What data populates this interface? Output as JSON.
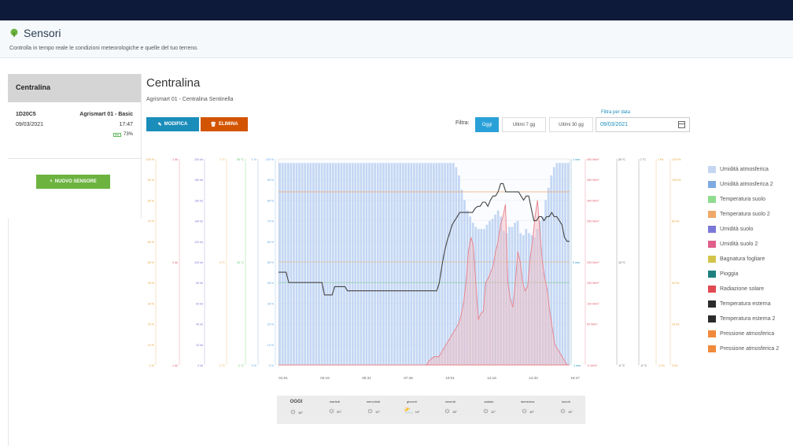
{
  "header": {
    "title": "Sensori",
    "subtitle": "Controlla in tempo reale le condizioni meteorologiche e quelle del tuo terreno."
  },
  "sidebar": {
    "heading": "Centralina",
    "sensor": {
      "id": "1D20C5",
      "model": "Agrismart 01 - Basic",
      "date": "09/03/2021",
      "time": "17:47",
      "battery": "73%"
    },
    "new_button": "NUOVO SENSORE"
  },
  "main": {
    "title": "Centralina",
    "subtitle": "Agrismart 01 - Centralina Sentinella",
    "edit_button": "MODIFICA",
    "delete_button": "ELIMINA",
    "filter_label": "Filtra:",
    "filters": [
      "Oggi",
      "Ultimi 7 gg",
      "Ultimi 30 gg"
    ],
    "active_filter": "Oggi",
    "date_filter_label": "Filtra per data",
    "date_value": "09/03/2021"
  },
  "colors": {
    "accent": "#1b8dbb",
    "danger": "#d35400",
    "success": "#6cb33f"
  },
  "chart_data": {
    "type": "line",
    "x_ticks": [
      "01:01",
      "03:16",
      "05:31",
      "07:46",
      "10:01",
      "12:16",
      "14:32",
      "16:47"
    ],
    "x_start": 0,
    "x_end": 1060,
    "axes_left": [
      {
        "color": "#e8a33a",
        "ticks": [
          "100 %",
          "90 %",
          "80 %",
          "70 %",
          "60 %",
          "50 %",
          "40 %",
          "30 %",
          "20 %",
          "10 %",
          "0 %"
        ]
      },
      {
        "color": "#e05a6a",
        "ticks": [
          "1 dk",
          "",
          "",
          "",
          "",
          "0 dk",
          "",
          "",
          "",
          "",
          "-1 dk"
        ]
      },
      {
        "color": "#7a7ad8",
        "ticks": [
          "200 kb",
          "180 kb",
          "160 kb",
          "140 kb",
          "120 kb",
          "100 kb",
          "80 kb",
          "60 kb",
          "40 kb",
          "20 kb",
          "0 kb"
        ]
      },
      {
        "color": "#e8a33a",
        "ticks": [
          "1 °C",
          "",
          "",
          "",
          "",
          "0 °C",
          "",
          "",
          "",
          "",
          "-1 °C"
        ]
      },
      {
        "color": "#5cc35c",
        "ticks": [
          "35 °C",
          "",
          "",
          "",
          "",
          "10 °C",
          "",
          "",
          "",
          "",
          "-1 °C"
        ]
      },
      {
        "color": "#5aa0e0",
        "ticks": [
          "1 %",
          "",
          "",
          "",
          "",
          "",
          "",
          "",
          "",
          "",
          "0 %"
        ]
      },
      {
        "color": "#5aa0e0",
        "ticks": [
          "100 %",
          "90 %",
          "80 %",
          "70 %",
          "60 %",
          "50 %",
          "40 %",
          "30 %",
          "20 %",
          "10 %",
          "0 %"
        ]
      }
    ],
    "axes_right": [
      {
        "color": "#1b8dbb",
        "ticks": [
          "1 mm",
          "",
          "",
          "",
          "",
          "0 mm",
          "",
          "",
          "",
          "",
          "-1 mm"
        ]
      },
      {
        "color": "#e05a6a",
        "ticks": [
          "400 W/m²",
          "350 W/m²",
          "300 W/m²",
          "250 W/m²",
          "",
          "200 W/m²",
          "150 W/m²",
          "100 W/m²",
          "50 W/m²",
          "",
          "-0 W/m²"
        ]
      },
      {
        "color": "#555555",
        "ticks": [
          "20 °C",
          "",
          "",
          "",
          "",
          "10 °C",
          "",
          "",
          "",
          "",
          "-0 °C"
        ]
      },
      {
        "color": "#555555",
        "ticks": [
          "1 °C",
          "",
          "",
          "",
          "",
          "",
          "",
          "",
          "",
          "",
          "-0 °C"
        ]
      },
      {
        "color": "#e8a33a",
        "ticks": [
          "1 Pa",
          "",
          "",
          "",
          "",
          "",
          "",
          "",
          "",
          "",
          "-1 Pa"
        ]
      },
      {
        "color": "#e8a33a",
        "ticks": [
          "120 Pa",
          "100 Pa",
          "",
          "80 Pa",
          "",
          "",
          "40 Pa",
          "",
          "20 Pa",
          "",
          "0 Pa"
        ]
      }
    ],
    "series": [
      {
        "name": "Umidità atmosferica",
        "color": "#b7cdf0",
        "kind": "bars",
        "values": [
          98,
          98,
          98,
          98,
          98,
          98,
          98,
          98,
          98,
          98,
          98,
          98,
          98,
          98,
          98,
          98,
          98,
          98,
          98,
          98,
          98,
          98,
          98,
          98,
          98,
          98,
          98,
          98,
          98,
          98,
          98,
          98,
          98,
          98,
          98,
          98,
          98,
          98,
          98,
          98,
          98,
          98,
          98,
          98,
          98,
          98,
          98,
          98,
          98,
          98,
          98,
          98,
          98,
          98,
          98,
          98,
          98,
          98,
          98,
          98,
          98,
          98,
          98,
          96,
          92,
          85,
          80,
          75,
          72,
          69,
          67,
          66,
          66,
          66,
          68,
          70,
          71,
          73,
          75,
          72,
          65,
          64,
          67,
          67,
          69,
          70,
          64,
          63,
          66,
          64,
          63,
          62,
          66,
          70,
          72,
          80,
          86,
          92,
          96,
          98,
          98,
          98,
          98,
          98
        ]
      },
      {
        "name": "Temperatura esterna",
        "color": "#444444",
        "kind": "line",
        "values": [
          45,
          45,
          45,
          45,
          40,
          40,
          40,
          40,
          40,
          40,
          40,
          40,
          40,
          40,
          40,
          40,
          40,
          40,
          34,
          34,
          34,
          34,
          38,
          38,
          38,
          38,
          38,
          36,
          36,
          36,
          36,
          36,
          36,
          36,
          36,
          36,
          36,
          36,
          36,
          36,
          36,
          36,
          36,
          36,
          36,
          36,
          36,
          36,
          36,
          36,
          36,
          36,
          36,
          36,
          36,
          36,
          36,
          36,
          36,
          36,
          36,
          36,
          36,
          40,
          48,
          55,
          60,
          64,
          68,
          70,
          72,
          74,
          74,
          74,
          74,
          74,
          74,
          76,
          77,
          77,
          79,
          79,
          77,
          80,
          82,
          82,
          84,
          88,
          88,
          84,
          84,
          84,
          84,
          84,
          84,
          82,
          80,
          82,
          82,
          76,
          70,
          70,
          72,
          72,
          70,
          72,
          72,
          74,
          72,
          72,
          70,
          68,
          62,
          60,
          60
        ]
      },
      {
        "name": "Radiazione solare",
        "color": "#e8808a",
        "kind": "area",
        "values": [
          0,
          0,
          0,
          0,
          0,
          0,
          0,
          0,
          0,
          0,
          0,
          0,
          0,
          0,
          0,
          0,
          0,
          0,
          0,
          0,
          0,
          0,
          0,
          0,
          0,
          0,
          0,
          0,
          0,
          0,
          0,
          0,
          0,
          0,
          0,
          0,
          0,
          0,
          0,
          0,
          0,
          0,
          0,
          0,
          0,
          0,
          0,
          0,
          0,
          0,
          0,
          0,
          0,
          0,
          0,
          0,
          0,
          0,
          0,
          0,
          0,
          2,
          3,
          4,
          4,
          4,
          6,
          8,
          10,
          12,
          14,
          16,
          18,
          20,
          24,
          30,
          40,
          55,
          62,
          58,
          40,
          22,
          25,
          26,
          40,
          42,
          45,
          48,
          55,
          60,
          68,
          72,
          78,
          40,
          32,
          28,
          40,
          55,
          50,
          40,
          36,
          38,
          52,
          60,
          72,
          80,
          64,
          50,
          42,
          36,
          26,
          18,
          10,
          8,
          6,
          4,
          2,
          0,
          0
        ]
      },
      {
        "name": "Pressione atmosferica",
        "color": "#f0a068",
        "kind": "step",
        "values": [
          84,
          84,
          84,
          84,
          84,
          84,
          84,
          84,
          84,
          84,
          84,
          84,
          84,
          84,
          84,
          84,
          84,
          84,
          84,
          84,
          84,
          84,
          84,
          84,
          84,
          84,
          84,
          84,
          84,
          84,
          84,
          84,
          84,
          84,
          84,
          84,
          84,
          84,
          84,
          84,
          84,
          84,
          84,
          84,
          84,
          84,
          84,
          84,
          84,
          84,
          84,
          84,
          84,
          84,
          84,
          84,
          84,
          84,
          84,
          84,
          84,
          84,
          84,
          84,
          84,
          84,
          84,
          84,
          84,
          84,
          84,
          84,
          84,
          84,
          84,
          84,
          84,
          84,
          84,
          84,
          84,
          84,
          84,
          84,
          84,
          84,
          84,
          84,
          84,
          84,
          84,
          84,
          84,
          84,
          84,
          84,
          84,
          84,
          84,
          84,
          84,
          84,
          84,
          84,
          84,
          84,
          84,
          84,
          84,
          84,
          84,
          84,
          84,
          84,
          84
        ]
      }
    ],
    "legend": [
      {
        "name": "Umidità atmosferica",
        "color": "#c5d6f2"
      },
      {
        "name": "Umidità atmosferica 2",
        "color": "#7faae0"
      },
      {
        "name": "Temperatura suolo",
        "color": "#8fdc8f"
      },
      {
        "name": "Temperatura suolo 2",
        "color": "#f0a868"
      },
      {
        "name": "Umidità suolo",
        "color": "#7a78d8"
      },
      {
        "name": "Umidità suolo 2",
        "color": "#e0608a"
      },
      {
        "name": "Bagnatura fogliare",
        "color": "#d2c44a"
      },
      {
        "name": "Pioggia",
        "color": "#1e7f80"
      },
      {
        "name": "Radiazione solare",
        "color": "#e04a52"
      },
      {
        "name": "Temperatura esterna",
        "color": "#2b2b2b"
      },
      {
        "name": "Temperatura esterna 2",
        "color": "#2b2b2b"
      },
      {
        "name": "Pressione atmosferica",
        "color": "#f08a3a"
      },
      {
        "name": "Pressione atmosferica 2",
        "color": "#f08a3a"
      }
    ]
  },
  "forecast": [
    {
      "day": "OGGI",
      "temp": "16°",
      "icon": "sun-icon"
    },
    {
      "day": "martedì",
      "temp": "20°",
      "icon": "sun-icon"
    },
    {
      "day": "mercoledì",
      "temp": "12°",
      "icon": "sun-icon"
    },
    {
      "day": "giovedì",
      "temp": "14°",
      "icon": "cloud-sun-icon"
    },
    {
      "day": "venerdì",
      "temp": "18°",
      "icon": "sun-icon"
    },
    {
      "day": "sabato",
      "temp": "12°",
      "icon": "sun-icon"
    },
    {
      "day": "domenica",
      "temp": "10°",
      "icon": "sun-icon"
    },
    {
      "day": "lunedì",
      "temp": "14°",
      "icon": "sun-icon"
    }
  ]
}
